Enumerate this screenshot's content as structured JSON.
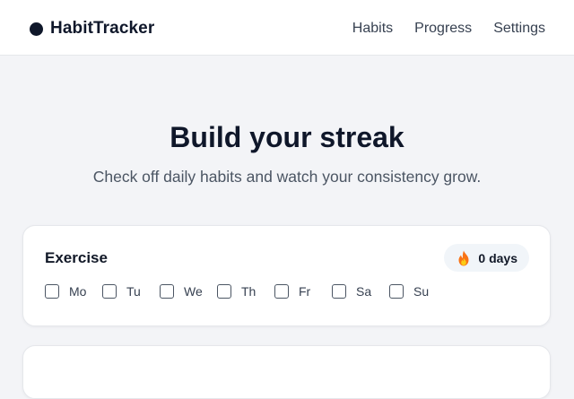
{
  "brand": {
    "name": "HabitTracker"
  },
  "nav": {
    "items": [
      "Habits",
      "Progress",
      "Settings"
    ]
  },
  "hero": {
    "title": "Build your streak",
    "subtitle": "Check off daily habits and watch your consistency grow."
  },
  "habits": [
    {
      "name": "Exercise",
      "streak_label": "0 days",
      "streak_icon": "flame-icon",
      "days": [
        {
          "label": "Mo",
          "checked": false
        },
        {
          "label": "Tu",
          "checked": false
        },
        {
          "label": "We",
          "checked": false
        },
        {
          "label": "Th",
          "checked": false
        },
        {
          "label": "Fr",
          "checked": false
        },
        {
          "label": "Sa",
          "checked": false
        },
        {
          "label": "Su",
          "checked": false
        }
      ]
    }
  ],
  "colors": {
    "accent": "#0f172a",
    "flame_outer": "#f97316",
    "flame_inner": "#facc15",
    "badge_bg": "#f1f5f9",
    "page_bg": "#f3f4f7"
  }
}
